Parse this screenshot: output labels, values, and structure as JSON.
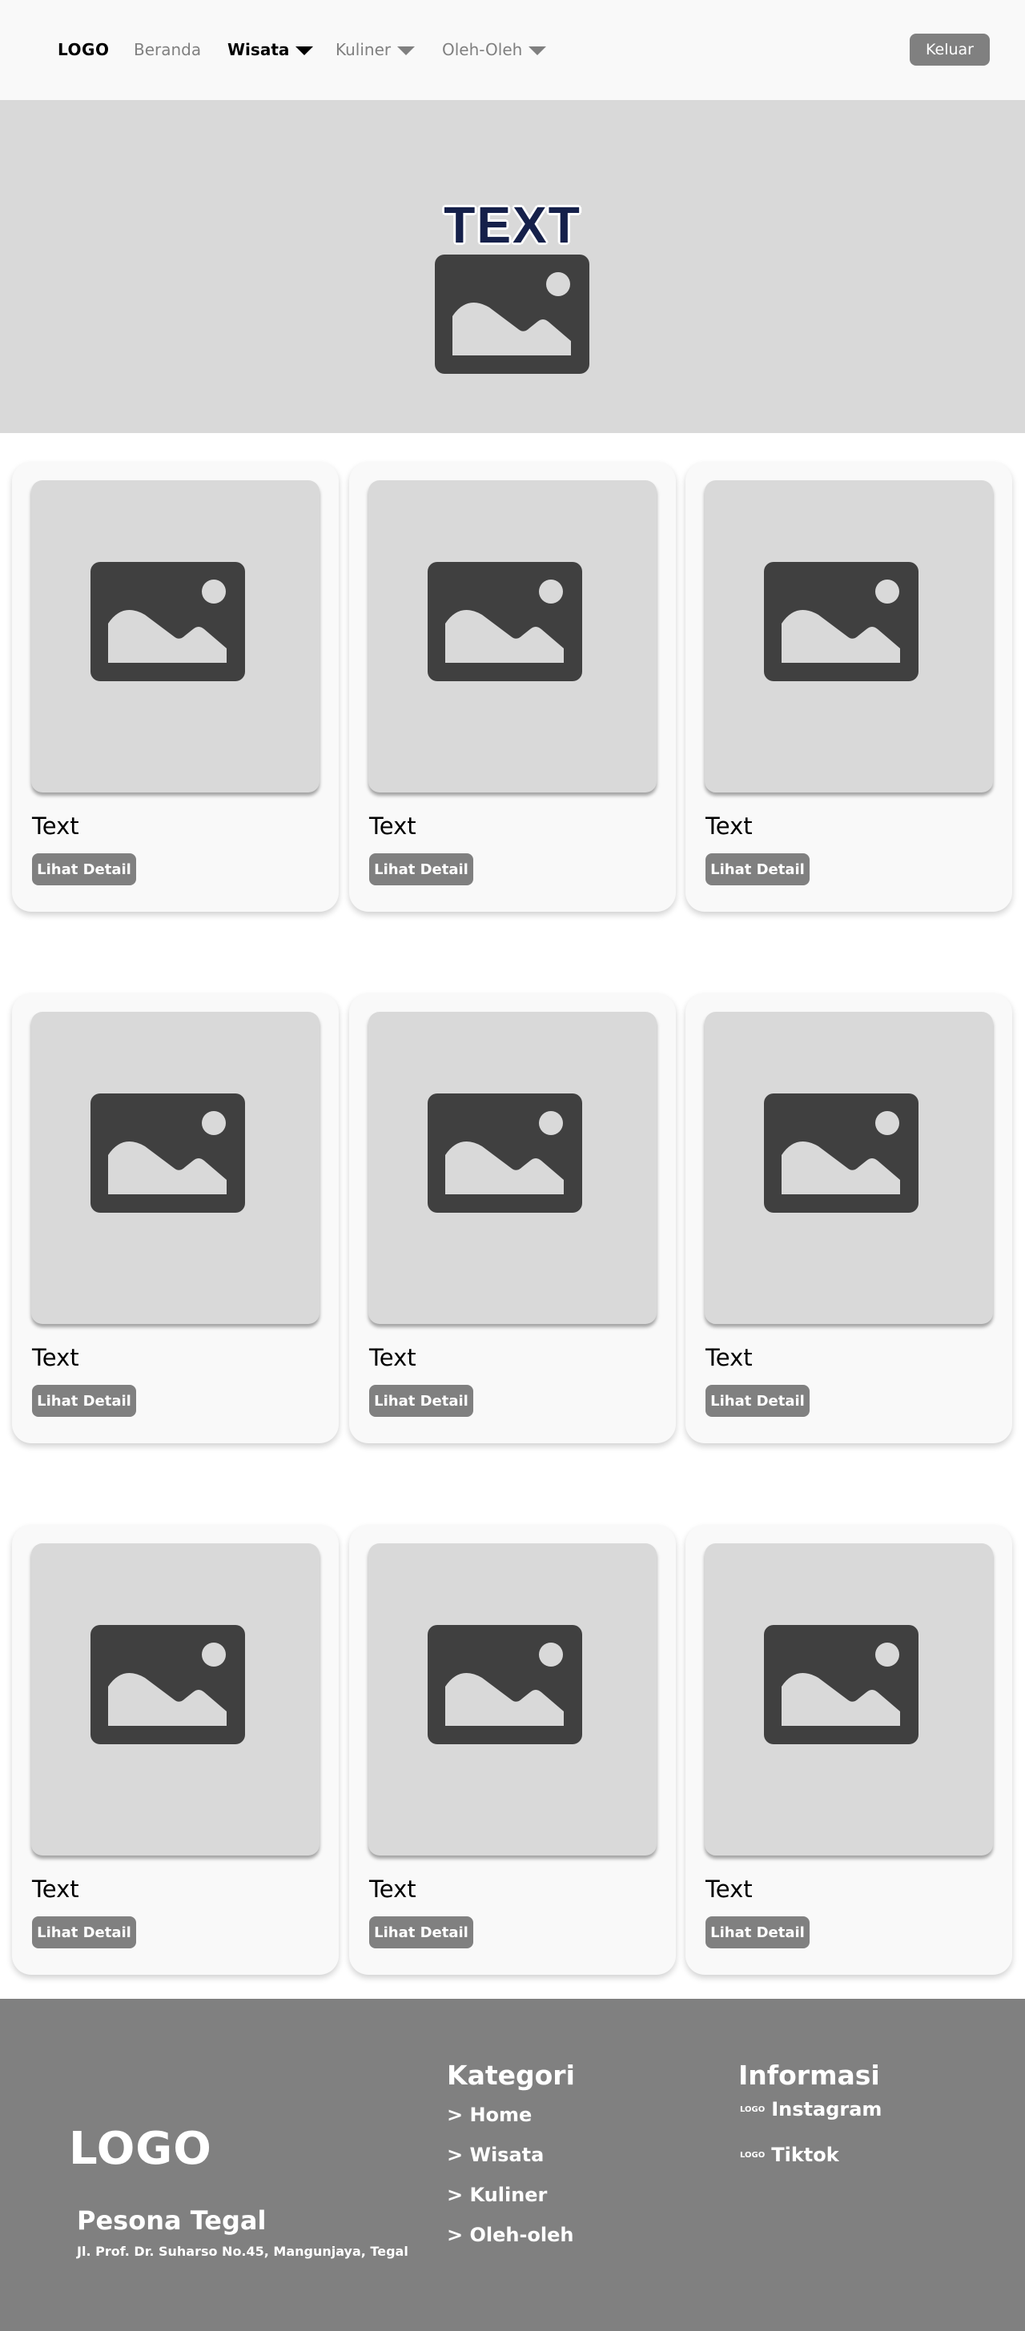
{
  "navbar": {
    "logo": "LOGO",
    "items": [
      {
        "label": "Beranda",
        "dropdown": false
      },
      {
        "label": "Wisata",
        "dropdown": true,
        "active": true
      },
      {
        "label": "Kuliner",
        "dropdown": true
      },
      {
        "label": "Oleh-Oleh",
        "dropdown": true
      }
    ],
    "logout_label": "Keluar"
  },
  "hero": {
    "title": "TEXT",
    "image_icon": "image-placeholder-icon"
  },
  "cards": [
    {
      "title": "Text",
      "button": "Lihat Detail"
    },
    {
      "title": "Text",
      "button": "Lihat Detail"
    },
    {
      "title": "Text",
      "button": "Lihat Detail"
    },
    {
      "title": "Text",
      "button": "Lihat Detail"
    },
    {
      "title": "Text",
      "button": "Lihat Detail"
    },
    {
      "title": "Text",
      "button": "Lihat Detail"
    },
    {
      "title": "Text",
      "button": "Lihat Detail"
    },
    {
      "title": "Text",
      "button": "Lihat Detail"
    },
    {
      "title": "Text",
      "button": "Lihat Detail"
    }
  ],
  "footer": {
    "logo": "LOGO",
    "name": "Pesona Tegal",
    "address": "Jl. Prof. Dr. Suharso No.45, Mangunjaya, Tegal",
    "kategori": {
      "heading": "Kategori",
      "links": [
        "> Home",
        "> Wisata",
        "> Kuliner",
        "> Oleh-oleh"
      ]
    },
    "informasi": {
      "heading": "Informasi",
      "links": [
        {
          "icon_text": "LOGO",
          "label": "Instagram"
        },
        {
          "icon_text": "LOGO",
          "label": "Tiktok"
        }
      ]
    }
  },
  "colors": {
    "navbar_bg": "#f9f9f9",
    "hero_bg": "#d9d9d9",
    "hero_title": "#15204a",
    "button_bg": "#808080",
    "card_bg": "#f9f9f9",
    "image_placeholder": "#d9d9d9",
    "icon_dark": "#404040",
    "footer_bg": "#808080"
  }
}
